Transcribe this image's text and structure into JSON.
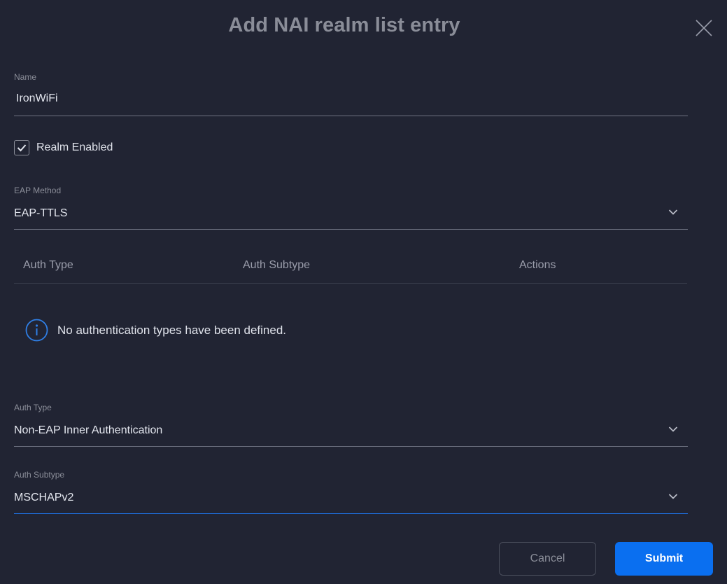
{
  "dialog": {
    "title": "Add NAI realm list entry"
  },
  "name_field": {
    "label": "Name",
    "value": "IronWiFi"
  },
  "realm_enabled": {
    "label": "Realm Enabled",
    "checked": true
  },
  "eap_method": {
    "label": "EAP Method",
    "value": "EAP-TTLS"
  },
  "auth_table": {
    "columns": [
      "Auth Type",
      "Auth Subtype",
      "Actions"
    ],
    "empty_message": "No authentication types have been defined."
  },
  "auth_type": {
    "label": "Auth Type",
    "value": "Non-EAP Inner Authentication"
  },
  "auth_subtype": {
    "label": "Auth Subtype",
    "value": "MSCHAPv2"
  },
  "buttons": {
    "cancel": "Cancel",
    "submit": "Submit"
  },
  "colors": {
    "background": "#212433",
    "accent": "#0a6ff0",
    "info": "#2f7fe6"
  },
  "icons": [
    "close-icon",
    "check-icon",
    "chevron-down-icon",
    "info-icon"
  ]
}
